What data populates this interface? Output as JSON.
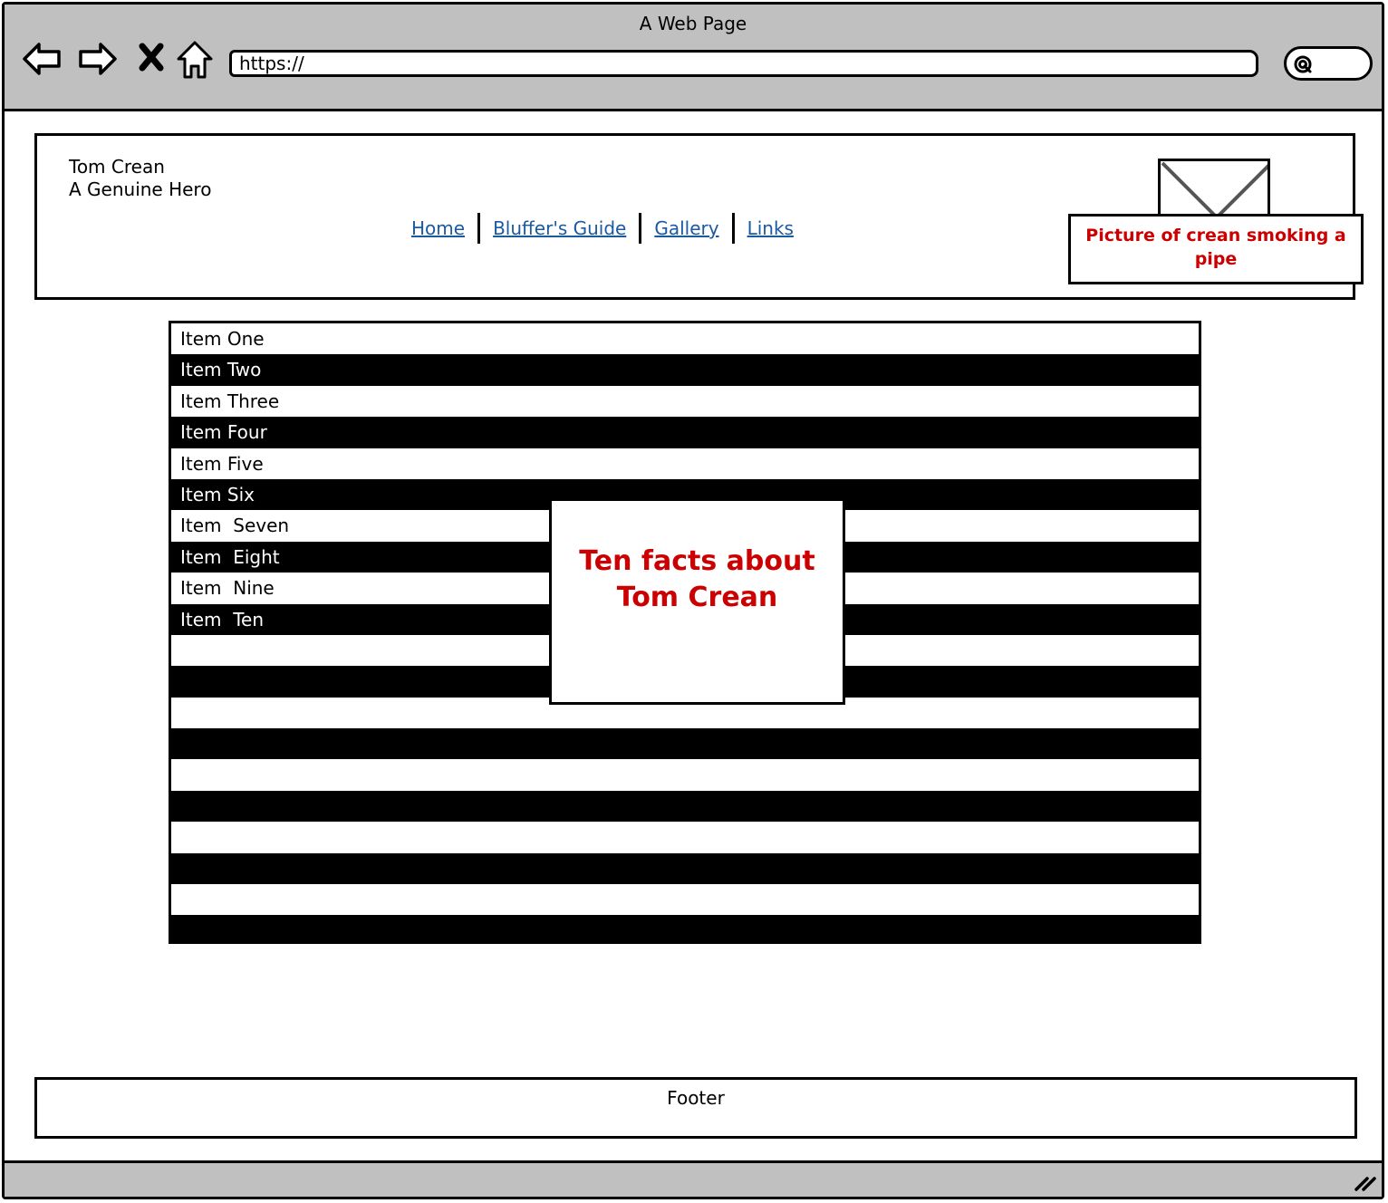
{
  "browser": {
    "window_title": "A Web Page",
    "url": "https://",
    "back_icon": "back-arrow-icon",
    "forward_icon": "forward-arrow-icon",
    "stop_icon": "close-icon",
    "home_icon": "home-icon",
    "search_icon": "search-icon"
  },
  "header": {
    "site_title": "Tom Crean",
    "tagline": "A Genuine Hero",
    "nav": [
      "Home",
      "Bluffer's Guide",
      "Gallery",
      "Links"
    ],
    "image_caption": "Picture of crean smoking a pipe"
  },
  "list": {
    "items": [
      "Item One",
      "Item Two",
      "Item Three",
      "Item Four",
      "Item Five",
      "Item Six",
      "Item  Seven",
      "Item  Eight",
      "Item  Nine",
      "Item  Ten",
      "",
      "",
      "",
      "",
      "",
      "",
      "",
      "",
      "",
      ""
    ]
  },
  "facts_box": {
    "title": "Ten facts about Tom Crean"
  },
  "footer": {
    "label": "Footer"
  },
  "colors": {
    "chrome": "#c0c0c0",
    "accent_red": "#cc0000",
    "link_blue": "#1a5aa0"
  }
}
